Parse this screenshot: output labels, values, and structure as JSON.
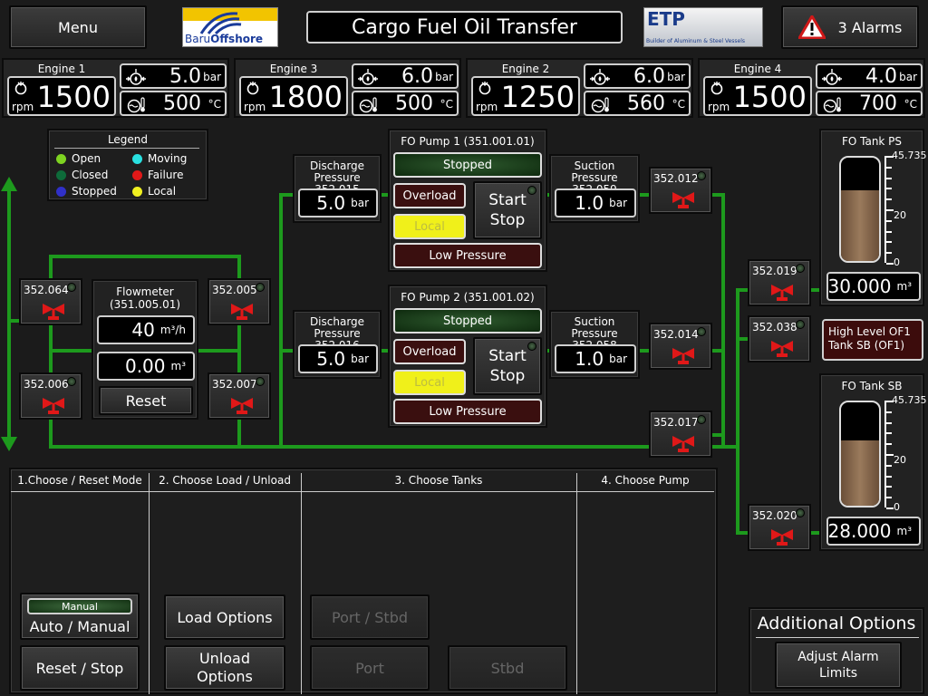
{
  "header": {
    "menu_label": "Menu",
    "logo1": {
      "text_a": "Baru",
      "text_b": "Offshore"
    },
    "title": "Cargo Fuel Oil Transfer",
    "logo2": {
      "text": "ETP",
      "sub": "Builder of Aluminum & Steel Vessels"
    },
    "alarms_label": "3 Alarms"
  },
  "engines": [
    {
      "name": "Engine 1",
      "rpm": "1500",
      "rpm_unit": "rpm",
      "pressure": "5.0",
      "pressure_unit": "bar",
      "temp": "500",
      "temp_unit": "°C"
    },
    {
      "name": "Engine 3",
      "rpm": "1800",
      "rpm_unit": "rpm",
      "pressure": "6.0",
      "pressure_unit": "bar",
      "temp": "500",
      "temp_unit": "°C"
    },
    {
      "name": "Engine 2",
      "rpm": "1250",
      "rpm_unit": "rpm",
      "pressure": "6.0",
      "pressure_unit": "bar",
      "temp": "560",
      "temp_unit": "°C"
    },
    {
      "name": "Engine 4",
      "rpm": "1500",
      "rpm_unit": "rpm",
      "pressure": "4.0",
      "pressure_unit": "bar",
      "temp": "700",
      "temp_unit": "°C"
    }
  ],
  "legend": {
    "title": "Legend",
    "items": [
      {
        "label": "Open",
        "color": "#7ed321"
      },
      {
        "label": "Moving",
        "color": "#29e0e0"
      },
      {
        "label": "Closed",
        "color": "#0e6b3a"
      },
      {
        "label": "Failure",
        "color": "#e01818"
      },
      {
        "label": "Stopped",
        "color": "#3030c8"
      },
      {
        "label": "Local",
        "color": "#f0f020"
      }
    ]
  },
  "valves": {
    "v064": "352.064",
    "v006": "352.006",
    "v005": "352.005",
    "v007": "352.007",
    "v012": "352.012",
    "v014": "352.014",
    "v017": "352.017",
    "v019": "352.019",
    "v038": "352.038",
    "v020": "352.020"
  },
  "flowmeter": {
    "title": "Flowmeter",
    "id": "(351.005.01)",
    "rate": "40",
    "rate_unit": "m³/h",
    "total": "0.00",
    "total_unit": "m³",
    "reset_label": "Reset"
  },
  "pump1": {
    "title": "FO Pump 1 (351.001.01)",
    "status": "Stopped",
    "overload": "Overload",
    "local": "Local",
    "start": "Start",
    "stop": "Stop",
    "low_pressure": "Low Pressure",
    "discharge_label": "Discharge",
    "discharge_label2": "Pressure 352.015",
    "discharge_value": "5.0",
    "discharge_unit": "bar",
    "suction_label": "Suction Pressure",
    "suction_label2": "352.059",
    "suction_value": "1.0",
    "suction_unit": "bar"
  },
  "pump2": {
    "title": "FO Pump 2 (351.001.02)",
    "status": "Stopped",
    "overload": "Overload",
    "local": "Local",
    "start": "Start",
    "stop": "Stop",
    "low_pressure": "Low Pressure",
    "discharge_label": "Discharge",
    "discharge_label2": "Pressure 352.016",
    "discharge_value": "5.0",
    "discharge_unit": "bar",
    "suction_label": "Suction Pressure",
    "suction_label2": "352.058",
    "suction_value": "1.0",
    "suction_unit": "bar"
  },
  "tank_ps": {
    "title": "FO Tank PS",
    "max": "45.735",
    "mid": "20",
    "min": "0",
    "value": "30.000",
    "unit": "m³",
    "fill_fraction": 0.66
  },
  "tank_sb": {
    "title": "FO Tank SB",
    "max": "45.735",
    "mid": "20",
    "min": "0",
    "value": "28.000",
    "unit": "m³",
    "fill_fraction": 0.61
  },
  "high_level_alarm": {
    "line1": "High Level OF1",
    "line2": "Tank SB (OF1)"
  },
  "steps": {
    "s1": "1.Choose / Reset Mode",
    "s2": "2. Choose Load / Unload",
    "s3": "3. Choose Tanks",
    "s4": "4. Choose Pump"
  },
  "controls": {
    "manual_indicator": "Manual",
    "auto_manual": "Auto / Manual",
    "reset_stop": "Reset / Stop",
    "load_options": "Load Options",
    "unload_line1": "Unload",
    "unload_line2": "Options",
    "port_stbd": "Port / Stbd",
    "port": "Port",
    "stbd": "Stbd"
  },
  "additional": {
    "title": "Additional Options",
    "adjust_line1": "Adjust Alarm",
    "adjust_line2": "Limits"
  },
  "colors": {
    "pipe": "#1d9a1d",
    "stopped_green": "#1f4a1f",
    "overload_red": "#4a1010",
    "local_yellow": "#f3f31d"
  }
}
